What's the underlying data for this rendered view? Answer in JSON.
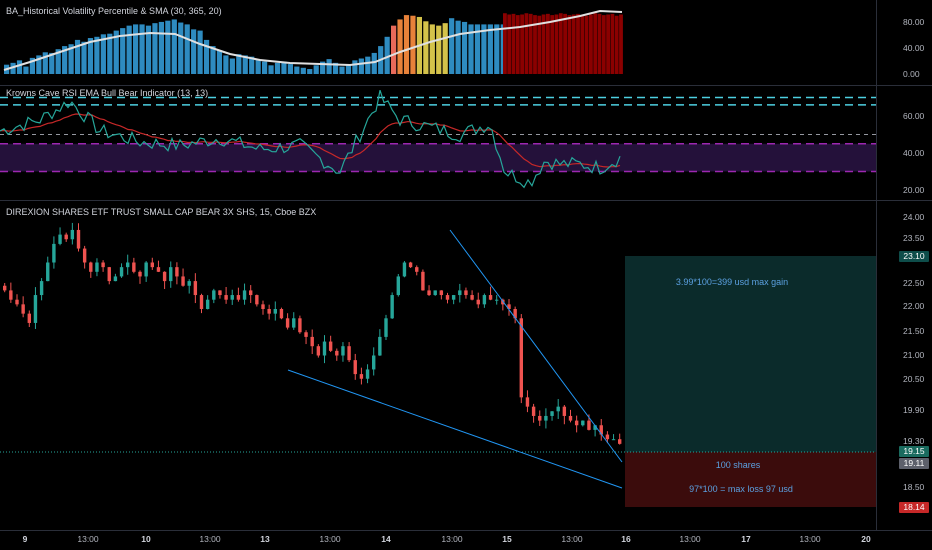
{
  "panes": {
    "hvp": {
      "title": "BA_Historical Volatility Percentile & SMA (30, 365, 20)",
      "y_labels": [
        "80.00",
        "40.00",
        "0.00"
      ]
    },
    "rsi": {
      "title": "Krowns Cave RSI EMA Bull Bear Indicator (13, 13)",
      "y_labels": [
        "60.00",
        "40.00",
        "20.00"
      ]
    },
    "price": {
      "title": "DIREXION SHARES ETF TRUST SMALL CAP BEAR 3X SHS, 15, Cboe BZX",
      "y_labels": [
        "24.00",
        "23.50",
        "22.50",
        "22.00",
        "21.50",
        "21.00",
        "20.50",
        "19.90",
        "19.30",
        "18.50"
      ],
      "tags": {
        "target": "23.10",
        "current": "19.15",
        "last": "19.11",
        "stop": "18.14"
      }
    }
  },
  "position_box": {
    "gain_text": "3.99*100=399 usd max gain",
    "shares_text": "100 shares",
    "loss_text": "97*100 = max loss 97 usd"
  },
  "time_axis": [
    "9",
    "13:00",
    "10",
    "13:00",
    "13",
    "13:00",
    "14",
    "13:00",
    "15",
    "13:00",
    "16",
    "13:00",
    "17",
    "13:00",
    "20"
  ],
  "colors": {
    "bull": "#26a69a",
    "bear": "#ef5350",
    "hvp_blue": "#2e8bc0",
    "hvp_red": "#8b0000",
    "rsi_cyan": "#4dd0e1",
    "rsi_purple": "#9c27b0",
    "gain_box": "#0b2b2b",
    "loss_box": "#3b0c0c",
    "trendline": "#2196f3"
  },
  "chart_data": [
    {
      "type": "bar",
      "title": "BA_Historical Volatility Percentile & SMA (30, 365, 20)",
      "ylim": [
        0,
        100
      ],
      "note_series": [
        "HVP columns",
        "SMA line"
      ],
      "values_start": [
        15,
        18,
        22,
        12,
        26,
        30,
        35,
        34,
        40,
        45,
        48,
        55,
        52,
        58,
        60,
        64,
        65,
        70,
        74,
        78,
        80,
        80,
        78,
        82,
        84,
        86,
        88,
        83,
        80,
        72,
        70,
        55,
        45,
        38,
        30,
        25,
        32,
        30,
        28,
        24,
        20,
        14,
        18,
        20,
        16,
        12,
        10,
        8,
        14,
        20,
        24,
        18,
        12,
        16,
        22,
        25,
        28,
        34,
        45,
        60,
        78,
        88,
        95,
        94,
        92,
        85,
        80,
        78,
        82,
        90,
        86,
        84,
        80,
        80,
        80,
        80,
        80,
        80
      ],
      "values_end": [
        98,
        96,
        97,
        95,
        96,
        98,
        97,
        95,
        94,
        96,
        97,
        95,
        96,
        98,
        97,
        95,
        96,
        97,
        95,
        94,
        96,
        98,
        97,
        95,
        96,
        97,
        94,
        96
      ]
    },
    {
      "type": "line",
      "title": "Krowns Cave RSI EMA Bull Bear Indicator (13, 13)",
      "ylim": [
        15,
        72
      ]
    },
    {
      "type": "line",
      "title": "DIREXION SHARES ETF TRUST SMALL CAP BEAR 3X SHS, 15, Cboe BZX",
      "ylim": [
        18.0,
        24.2
      ],
      "series": [
        {
          "values": [
            22.4,
            22.2,
            22.1,
            21.9,
            21.7,
            22.3,
            22.6,
            23.0,
            23.4,
            23.6,
            23.5,
            23.7,
            23.3,
            23.0,
            22.8,
            23.0,
            22.9,
            22.6,
            22.7,
            22.9,
            23.0,
            22.8,
            22.7,
            23.0,
            22.9,
            22.8,
            22.6,
            22.9,
            22.7,
            22.5,
            22.6,
            22.3,
            22.0,
            22.2,
            22.4,
            22.3,
            22.2,
            22.3,
            22.2,
            22.4,
            22.3,
            22.1,
            22.0,
            21.9,
            22.0,
            21.8,
            21.6,
            21.8,
            21.5,
            21.4,
            21.2,
            21.0,
            21.3,
            21.1,
            21.0,
            21.2,
            20.9,
            20.6,
            20.5,
            20.7,
            21.0,
            21.4,
            21.8,
            22.3,
            22.7,
            23.0,
            22.9,
            22.8,
            22.4,
            22.3,
            22.4,
            22.3,
            22.2,
            22.3,
            22.4,
            22.3,
            22.2,
            22.1,
            22.3,
            22.2,
            22.2,
            22.1,
            22.0,
            21.8,
            20.1,
            19.9,
            19.7,
            19.6,
            19.7,
            19.8,
            19.9,
            19.7,
            19.6,
            19.5,
            19.6,
            19.4,
            19.5,
            19.3,
            19.2,
            19.2,
            19.1
          ]
        }
      ]
    }
  ]
}
